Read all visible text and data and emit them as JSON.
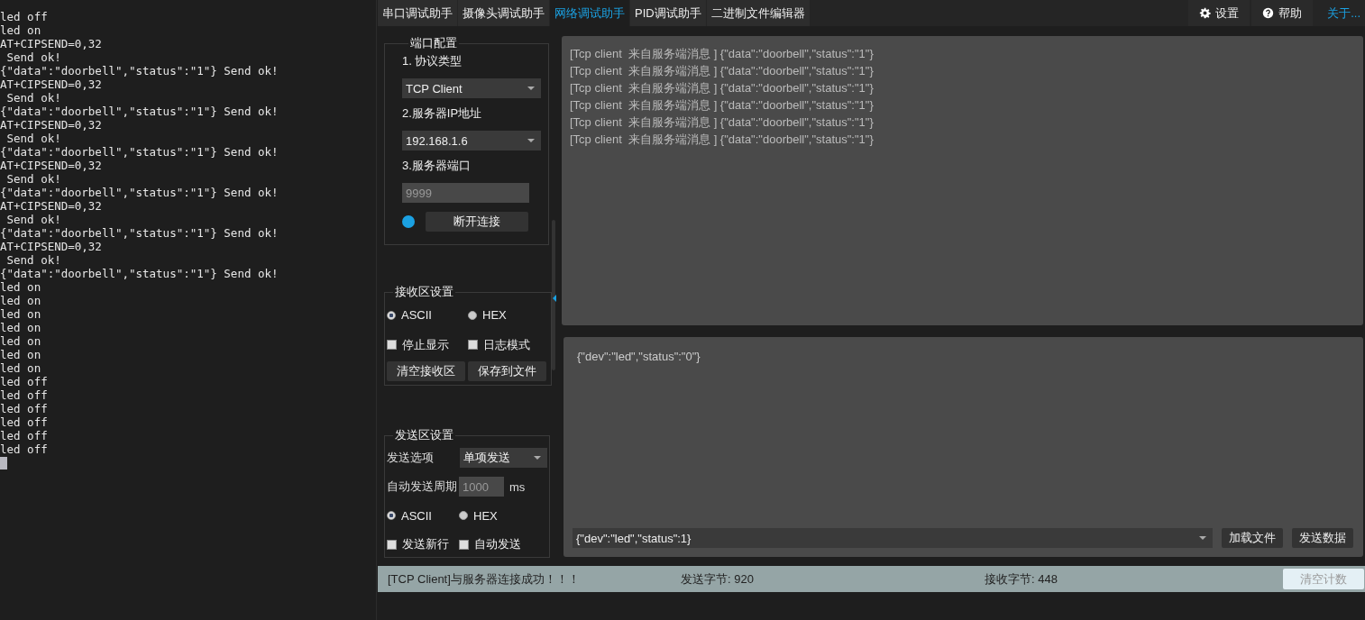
{
  "terminal": {
    "lines": [
      "led off",
      "led on",
      "AT+CIPSEND=0,32",
      " Send ok!",
      "{\"data\":\"doorbell\",\"status\":\"1\"} Send ok!",
      "AT+CIPSEND=0,32",
      " Send ok!",
      "{\"data\":\"doorbell\",\"status\":\"1\"} Send ok!",
      "AT+CIPSEND=0,32",
      " Send ok!",
      "{\"data\":\"doorbell\",\"status\":\"1\"} Send ok!",
      "AT+CIPSEND=0,32",
      " Send ok!",
      "{\"data\":\"doorbell\",\"status\":\"1\"} Send ok!",
      "AT+CIPSEND=0,32",
      " Send ok!",
      "{\"data\":\"doorbell\",\"status\":\"1\"} Send ok!",
      "AT+CIPSEND=0,32",
      " Send ok!",
      "{\"data\":\"doorbell\",\"status\":\"1\"} Send ok!",
      "led on",
      "led on",
      "led on",
      "led on",
      "led on",
      "led on",
      "led on",
      "led off",
      "led off",
      "led off",
      "led off",
      "led off",
      "led off"
    ]
  },
  "tabs": [
    {
      "label": "串口调试助手",
      "selected": false
    },
    {
      "label": "摄像头调试助手",
      "selected": false
    },
    {
      "label": "网络调试助手",
      "selected": true
    },
    {
      "label": "PID调试助手",
      "selected": false
    },
    {
      "label": "二进制文件编辑器",
      "selected": false
    }
  ],
  "top_buttons": [
    {
      "label": "设置",
      "kind": "settings"
    },
    {
      "label": "帮助",
      "kind": "help"
    },
    {
      "label": "关于...",
      "kind": "link"
    }
  ],
  "port_config": {
    "title": "端口配置",
    "protocol_label": "1. 协议类型",
    "protocol": "TCP Client",
    "ip_label": "2.服务器IP地址",
    "ip": "192.168.1.6",
    "port_label": "3.服务器端口",
    "port_placeholder": "9999",
    "connected": true,
    "connect_button": "断开连接"
  },
  "receive_settings": {
    "title": "接收区设置",
    "encodings": [
      {
        "label": "ASCII",
        "selected": true
      },
      {
        "label": "HEX",
        "selected": false
      }
    ],
    "options": [
      {
        "label": "停止显示",
        "checked": false
      },
      {
        "label": "日志模式",
        "checked": false
      }
    ],
    "buttons": [
      "清空接收区",
      "保存到文件"
    ]
  },
  "send_settings": {
    "title": "发送区设置",
    "send_option_label": "发送选项",
    "send_option": "单项发送",
    "period_label": "自动发送周期",
    "period_placeholder": "1000",
    "period_unit": "ms",
    "encodings": [
      {
        "label": "ASCII",
        "selected": true
      },
      {
        "label": "HEX",
        "selected": false
      }
    ],
    "options": [
      {
        "label": "发送新行",
        "checked": false
      },
      {
        "label": "自动发送",
        "checked": false
      }
    ]
  },
  "receive_messages": [
    "[Tcp client  来自服务端消息 ] {\"data\":\"doorbell\",\"status\":\"1\"}",
    "[Tcp client  来自服务端消息 ] {\"data\":\"doorbell\",\"status\":\"1\"}",
    "[Tcp client  来自服务端消息 ] {\"data\":\"doorbell\",\"status\":\"1\"}",
    "[Tcp client  来自服务端消息 ] {\"data\":\"doorbell\",\"status\":\"1\"}",
    "[Tcp client  来自服务端消息 ] {\"data\":\"doorbell\",\"status\":\"1\"}",
    "[Tcp client  来自服务端消息 ] {\"data\":\"doorbell\",\"status\":\"1\"}"
  ],
  "send_text": "{\"dev\":\"led\",\"status\":\"0\"}",
  "send_input": "{\"dev\":\"led\",\"status\":1}",
  "send_buttons": [
    "加载文件",
    "发送数据"
  ],
  "status_bar": {
    "message": "[TCP Client]与服务器连接成功！！！",
    "sent": "发送字节: 920",
    "received": "接收字节: 448",
    "clear_button": "清空计数"
  }
}
